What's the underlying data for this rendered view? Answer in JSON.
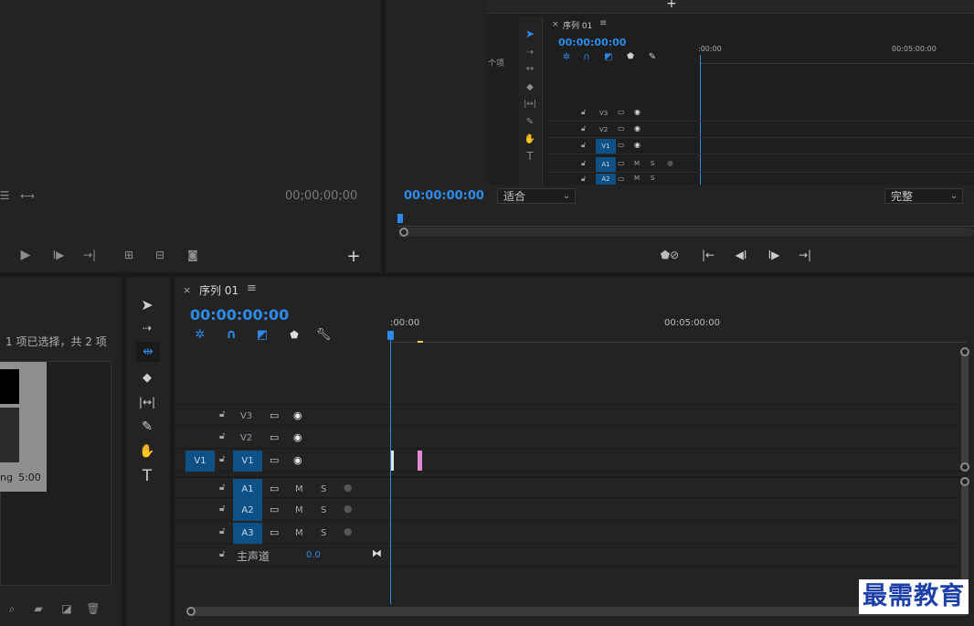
{
  "source_monitor": {
    "timecode": "00;00;00;00"
  },
  "program_monitor": {
    "timecode": "00:00:00:00",
    "fit_select": "适合",
    "quality_select": "完整",
    "mini_sequence": {
      "tab_title": "序列 01",
      "timecode": "00:00:00:00",
      "ruler_start": ":00:00",
      "ruler_mid": "00:05:00:00",
      "project_label": "个项",
      "tracks": [
        "V3",
        "V2",
        "V1",
        "A1",
        "A2"
      ],
      "mute": "M",
      "solo": "S"
    }
  },
  "project_panel": {
    "selection_text": "1 项已选择，共 2 项",
    "clip_name": "ng",
    "clip_duration": "5:00"
  },
  "timeline": {
    "tab_title": "序列 01",
    "timecode": "00:00:00:00",
    "ruler_start": ":00:00",
    "ruler_mid": "00:05:00:00",
    "video_tracks": [
      {
        "name": "V3",
        "source": ""
      },
      {
        "name": "V2",
        "source": ""
      },
      {
        "name": "V1",
        "source": "V1"
      }
    ],
    "audio_tracks": [
      {
        "name": "A1",
        "mute": "M",
        "solo": "S"
      },
      {
        "name": "A2",
        "mute": "M",
        "solo": "S"
      },
      {
        "name": "A3",
        "mute": "M",
        "solo": "S"
      }
    ],
    "master": {
      "label": "主声道",
      "value": "0.0"
    }
  },
  "watermark": "最需教育",
  "colors": {
    "accent_blue": "#2d8ceb",
    "track_target": "#0d5186",
    "clip_pink": "#e58ad0"
  },
  "icons": {
    "add": "plus-icon",
    "wrench": "wrench-icon",
    "marker": "marker-icon"
  }
}
